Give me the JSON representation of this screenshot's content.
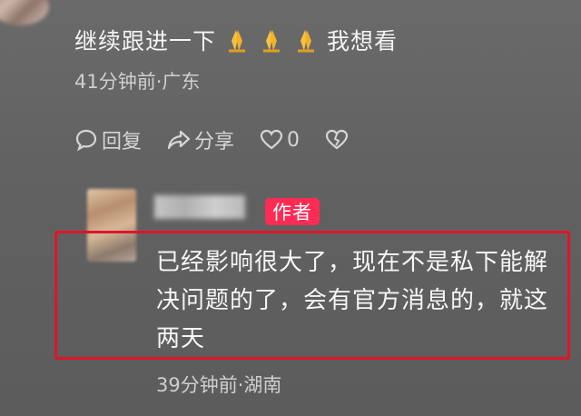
{
  "parent_comment": {
    "text": "继续跟进一下",
    "emojis": [
      "prayer-hands-icon",
      "prayer-hands-icon",
      "prayer-hands-icon"
    ],
    "text_after": "我想看",
    "meta": "41分钟前·广东"
  },
  "actions": {
    "reply_label": "回复",
    "share_label": "分享",
    "like_count": "0"
  },
  "reply": {
    "badge": "作者",
    "text": "已经影响很大了，现在不是私下能解决问题的了，会有官方消息的，就这两天",
    "meta": "39分钟前·湖南"
  },
  "colors": {
    "badge": "#fe2c55",
    "highlight_border": "#e0142a"
  }
}
